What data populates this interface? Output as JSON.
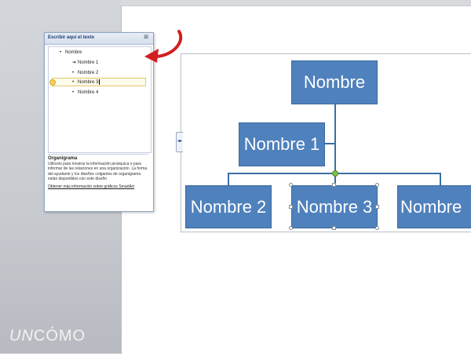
{
  "text_pane": {
    "title": "Escribir aquí el texto",
    "close_glyph": "⊠",
    "items": [
      {
        "label": "Nombre",
        "bullet": "•"
      },
      {
        "label": "Nombre 1",
        "bullet": "➔"
      },
      {
        "label": "Nombre 2",
        "bullet": "•"
      },
      {
        "label": "Nombre 3",
        "bullet": "•"
      },
      {
        "label": "Nombre 4",
        "bullet": "•"
      }
    ],
    "description_title": "Organigrama",
    "description_body": "Utilícelo para mostrar la información jerárquica o para informar de las relaciones en una organización. La forma del ayudante y los diseños colgantes de organigrama están disponibles con este diseño",
    "description_link": "Obtener más información sobre gráficos SmartArt"
  },
  "diagram": {
    "top": "Nombre",
    "assistant": "Nombre 1",
    "children": [
      "Nombre 2",
      "Nombre 3",
      "Nombre"
    ],
    "box_color": "#4f81bd"
  },
  "annotation_arrow_color": "#d11f1f",
  "watermark": {
    "part1": "UN",
    "part2": "CÓMO"
  }
}
